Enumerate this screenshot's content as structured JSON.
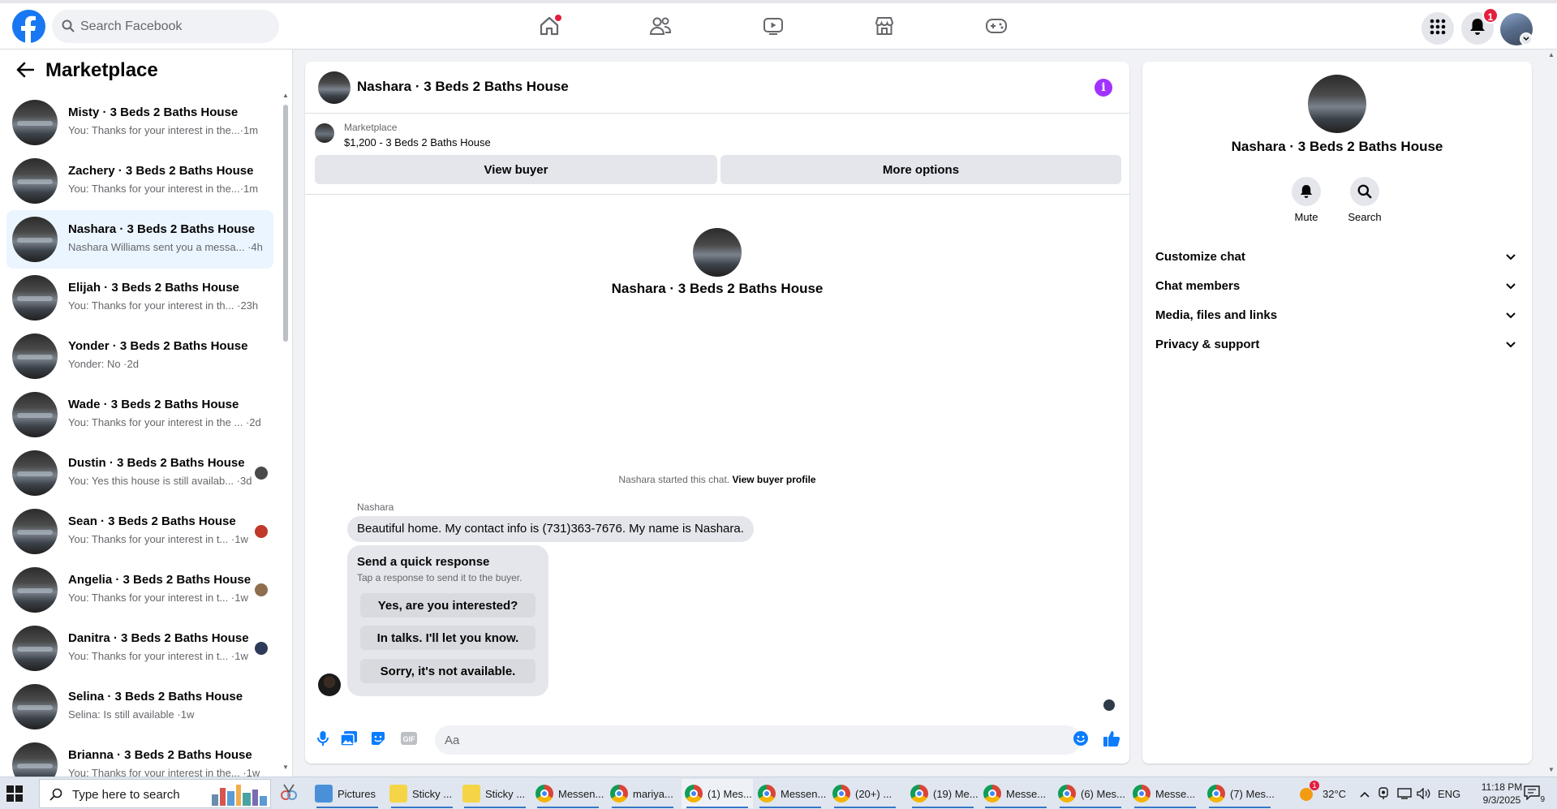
{
  "topnav": {
    "search_placeholder": "Search Facebook",
    "notifications_count": "1",
    "icons": [
      "home-icon",
      "friends-icon",
      "watch-icon",
      "marketplace-icon",
      "gaming-icon"
    ]
  },
  "sidebar": {
    "title": "Marketplace",
    "conversations": [
      {
        "name": "Misty · 3 Beds 2 Baths House",
        "preview": "You: Thanks for your interest in the...·1m",
        "active": false,
        "mini": false
      },
      {
        "name": "Zachery · 3 Beds 2 Baths House",
        "preview": "You: Thanks for your interest in the...·1m",
        "active": false,
        "mini": false
      },
      {
        "name": "Nashara · 3 Beds 2 Baths House",
        "preview": "Nashara Williams sent you a messa... ·4h",
        "active": true,
        "mini": false
      },
      {
        "name": "Elijah · 3 Beds 2 Baths House",
        "preview": "You: Thanks for your interest in th... ·23h",
        "active": false,
        "mini": false
      },
      {
        "name": "Yonder · 3 Beds 2 Baths House",
        "preview": "Yonder: No ·2d",
        "active": false,
        "mini": false
      },
      {
        "name": "Wade · 3 Beds 2 Baths House",
        "preview": "You: Thanks for your interest in the ... ·2d",
        "active": false,
        "mini": false
      },
      {
        "name": "Dustin · 3 Beds 2 Baths House",
        "preview": "You: Yes this house is still availab... ·3d",
        "active": false,
        "mini": true
      },
      {
        "name": "Sean · 3 Beds 2 Baths House",
        "preview": "You: Thanks for your interest in t... ·1w",
        "active": false,
        "mini": true
      },
      {
        "name": "Angelia · 3 Beds 2 Baths House",
        "preview": "You: Thanks for your interest in t... ·1w",
        "active": false,
        "mini": true
      },
      {
        "name": "Danitra · 3 Beds 2 Baths House",
        "preview": "You: Thanks for your interest in t... ·1w",
        "active": false,
        "mini": true
      },
      {
        "name": "Selina · 3 Beds 2 Baths House",
        "preview": "Selina: Is still available ·1w",
        "active": false,
        "mini": false
      },
      {
        "name": "Brianna · 3 Beds 2 Baths House",
        "preview": "You: Thanks for your interest in the... ·1w",
        "active": false,
        "mini": false
      }
    ]
  },
  "chat": {
    "title": "Nashara · 3 Beds 2 Baths House",
    "listing_category": "Marketplace",
    "listing_price": "$1,200 - 3 Beds 2 Baths House",
    "view_buyer_label": "View buyer",
    "more_options_label": "More options",
    "intro_name": "Nashara · 3 Beds 2 Baths House",
    "started_text": "Nashara started this chat.",
    "view_profile_label": "View buyer profile",
    "sender": "Nashara",
    "message": "Beautiful home. My contact info is (731)363-7676. My name is Nashara.",
    "quick_title": "Send a quick response",
    "quick_subtitle": "Tap a response to send it to the buyer.",
    "quick_responses": [
      "Yes, are you interested?",
      "In talks. I'll let you know.",
      "Sorry, it's not available."
    ],
    "composer_placeholder": "Aa"
  },
  "rightpanel": {
    "name": "Nashara · 3 Beds 2 Baths House",
    "mute_label": "Mute",
    "search_label": "Search",
    "sections": [
      "Customize chat",
      "Chat members",
      "Media, files and links",
      "Privacy & support"
    ]
  },
  "taskbar": {
    "search_text": "Type here to search",
    "apps": [
      {
        "label": "Pictures",
        "icon": "pics",
        "running": true
      },
      {
        "label": "Sticky ...",
        "icon": "sticky",
        "running": true
      },
      {
        "label": "Sticky ...",
        "icon": "sticky",
        "running": true
      },
      {
        "label": "Messen...",
        "icon": "chrome",
        "running": true
      },
      {
        "label": "mariya...",
        "icon": "chrome",
        "running": true
      },
      {
        "label": "(1) Mes...",
        "icon": "chrome",
        "running": true
      },
      {
        "label": "Messen...",
        "icon": "chrome",
        "running": true
      },
      {
        "label": "(20+) ...",
        "icon": "chrome",
        "running": true
      },
      {
        "label": "(19) Me...",
        "icon": "chrome",
        "running": true
      },
      {
        "label": "Messe...",
        "icon": "chrome",
        "running": true
      },
      {
        "label": "(6) Mes...",
        "icon": "chrome",
        "running": true
      },
      {
        "label": "Messe...",
        "icon": "chrome",
        "running": true
      },
      {
        "label": "(7) Mes...",
        "icon": "chrome",
        "running": true
      }
    ],
    "weather": "32°C",
    "language": "ENG",
    "time": "11:18 PM",
    "date": "9/3/2025",
    "notif_count": "9"
  },
  "colors": {
    "brand": "#1877f2",
    "info": "#a033ff",
    "badge": "#e41e3f",
    "active_row": "#ebf5ff"
  }
}
